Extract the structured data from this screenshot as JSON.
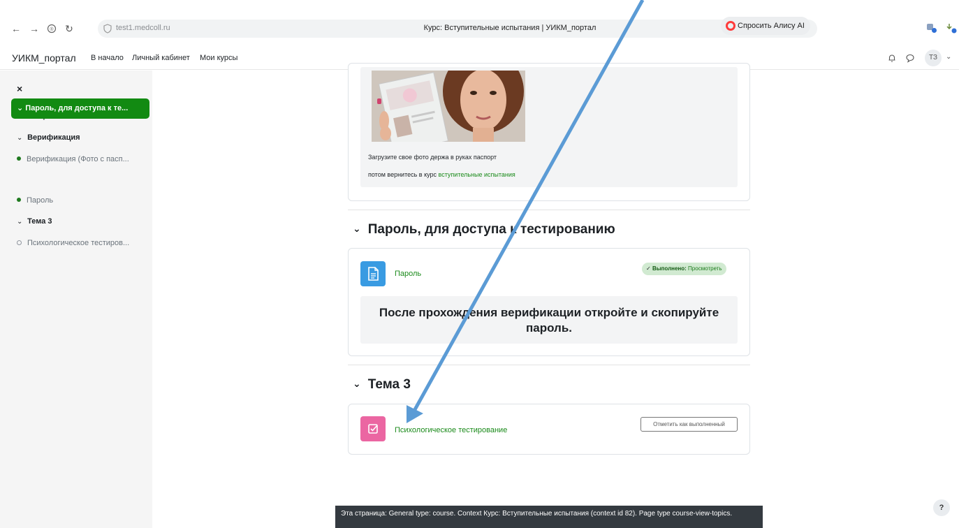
{
  "browser": {
    "url": "test1.medcoll.ru",
    "tab_title": "Курс: Вступительные испытания | УИКМ_портал",
    "more": "···",
    "alice_button": "Спросить Алису AI"
  },
  "navbar": {
    "brand": "УИКМ_портал",
    "links": [
      "В начало",
      "Личный кабинет",
      "Мои курсы"
    ],
    "avatar_initials": "ТЗ"
  },
  "sidebar": {
    "close": "×",
    "sections": [
      {
        "label": "Общее"
      },
      {
        "label": "Верификация"
      },
      {
        "label": "Пароль, для доступа к те..."
      },
      {
        "label": "Тема 3"
      }
    ],
    "items": [
      {
        "label": "Верификация (Фото с пасп...",
        "status": "done"
      },
      {
        "label": "Пароль",
        "status": "done"
      },
      {
        "label": "Психологическое тестиров...",
        "status": "not-done"
      }
    ]
  },
  "main": {
    "verification": {
      "text1": "Загрузите свое фото держа в руках паспорт",
      "text2_prefix": "потом вернитесь в курс ",
      "text2_link": "вступительные испытания"
    },
    "password_section": {
      "title": "Пароль, для доступа к тестированию",
      "activity_name": "Пароль",
      "badge_label": "Выполнено:",
      "badge_value": "Просмотреть",
      "instruction": "После прохождения верификации откройте и скопируйте пароль."
    },
    "topic3_section": {
      "title": "Тема 3",
      "activity_name": "Психологическое тестирование",
      "mark_button": "Отметить как выполненный"
    }
  },
  "footer": {
    "text": "Эта страница: General type: course. Context Курс: Вступительные испытания (context id 82). Page type course-view-topics."
  },
  "help": "?",
  "colors": {
    "accent_green": "#128a12",
    "link_green": "#1a8a1a",
    "resource_blue": "#399be2",
    "assign_pink": "#eb66a2",
    "arrow_blue": "#5b9bd5"
  },
  "icons": {
    "back": "arrow-left-icon",
    "forward": "arrow-right-icon",
    "reload": "reload-icon",
    "bell": "bell-icon",
    "chat": "chat-icon"
  }
}
